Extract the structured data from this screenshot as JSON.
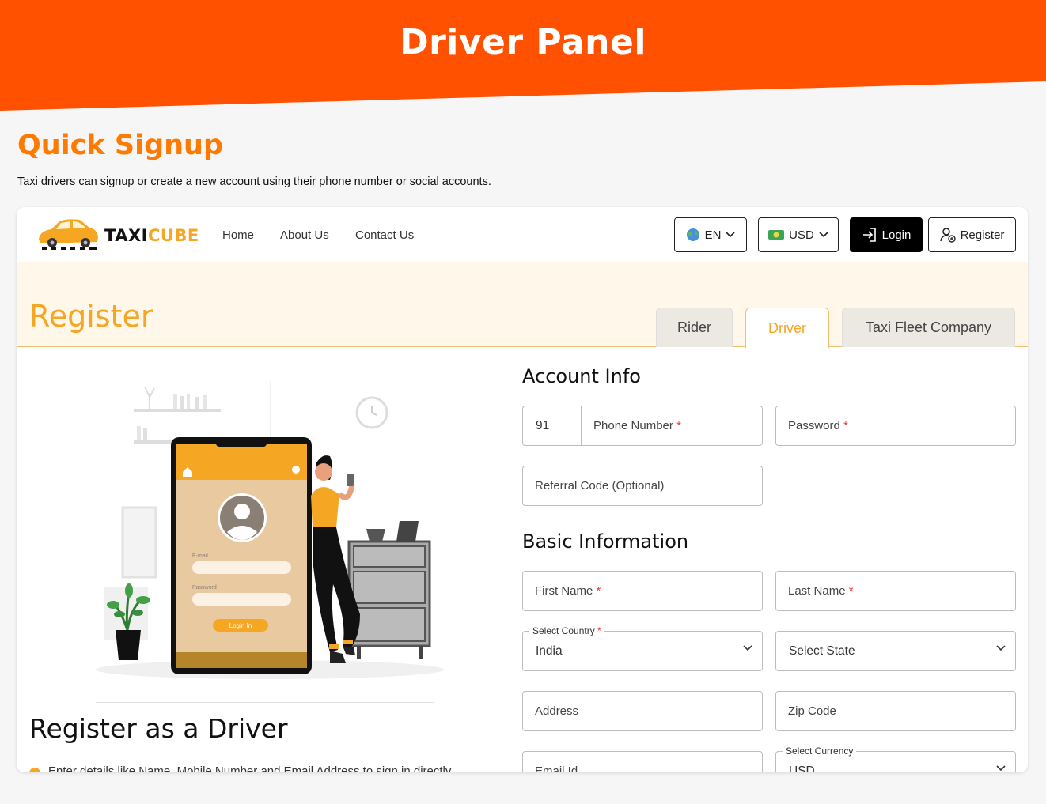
{
  "hero": {
    "title": "Driver Panel",
    "color": "#ff5100"
  },
  "quick_signup": {
    "title": "Quick Signup",
    "description": "Taxi drivers can signup or create a new account using their phone number or social accounts."
  },
  "nav": {
    "logo_part1": "TAXI",
    "logo_part2": "CUBE",
    "links": [
      "Home",
      "About Us",
      "Contact Us"
    ],
    "language": "EN",
    "currency": "USD",
    "login": "Login",
    "register": "Register"
  },
  "register": {
    "title": "Register",
    "tabs": [
      "Rider",
      "Driver",
      "Taxi Fleet Company"
    ],
    "active_tab": "Driver"
  },
  "illustration": {
    "email_label": "E-mail",
    "password_label": "Password",
    "login_btn": "Login In"
  },
  "left": {
    "heading": "Register as a Driver",
    "bullet": "Enter details like Name, Mobile Number and Email Address to sign in directly"
  },
  "account_info": {
    "title": "Account Info",
    "country_code": "91",
    "phone": "Phone Number",
    "password": "Password",
    "referral": "Referral Code (Optional)"
  },
  "basic_info": {
    "title": "Basic Information",
    "first_name": "First Name",
    "last_name": "Last Name",
    "country_label": "Select Country",
    "country_value": "India",
    "state": "Select State",
    "address": "Address",
    "zip": "Zip Code",
    "email": "Email Id",
    "currency_label": "Select Currency",
    "currency_value": "USD"
  },
  "colors": {
    "accent": "#f5a623",
    "brand": "#ff5100",
    "required": "#e53935"
  }
}
